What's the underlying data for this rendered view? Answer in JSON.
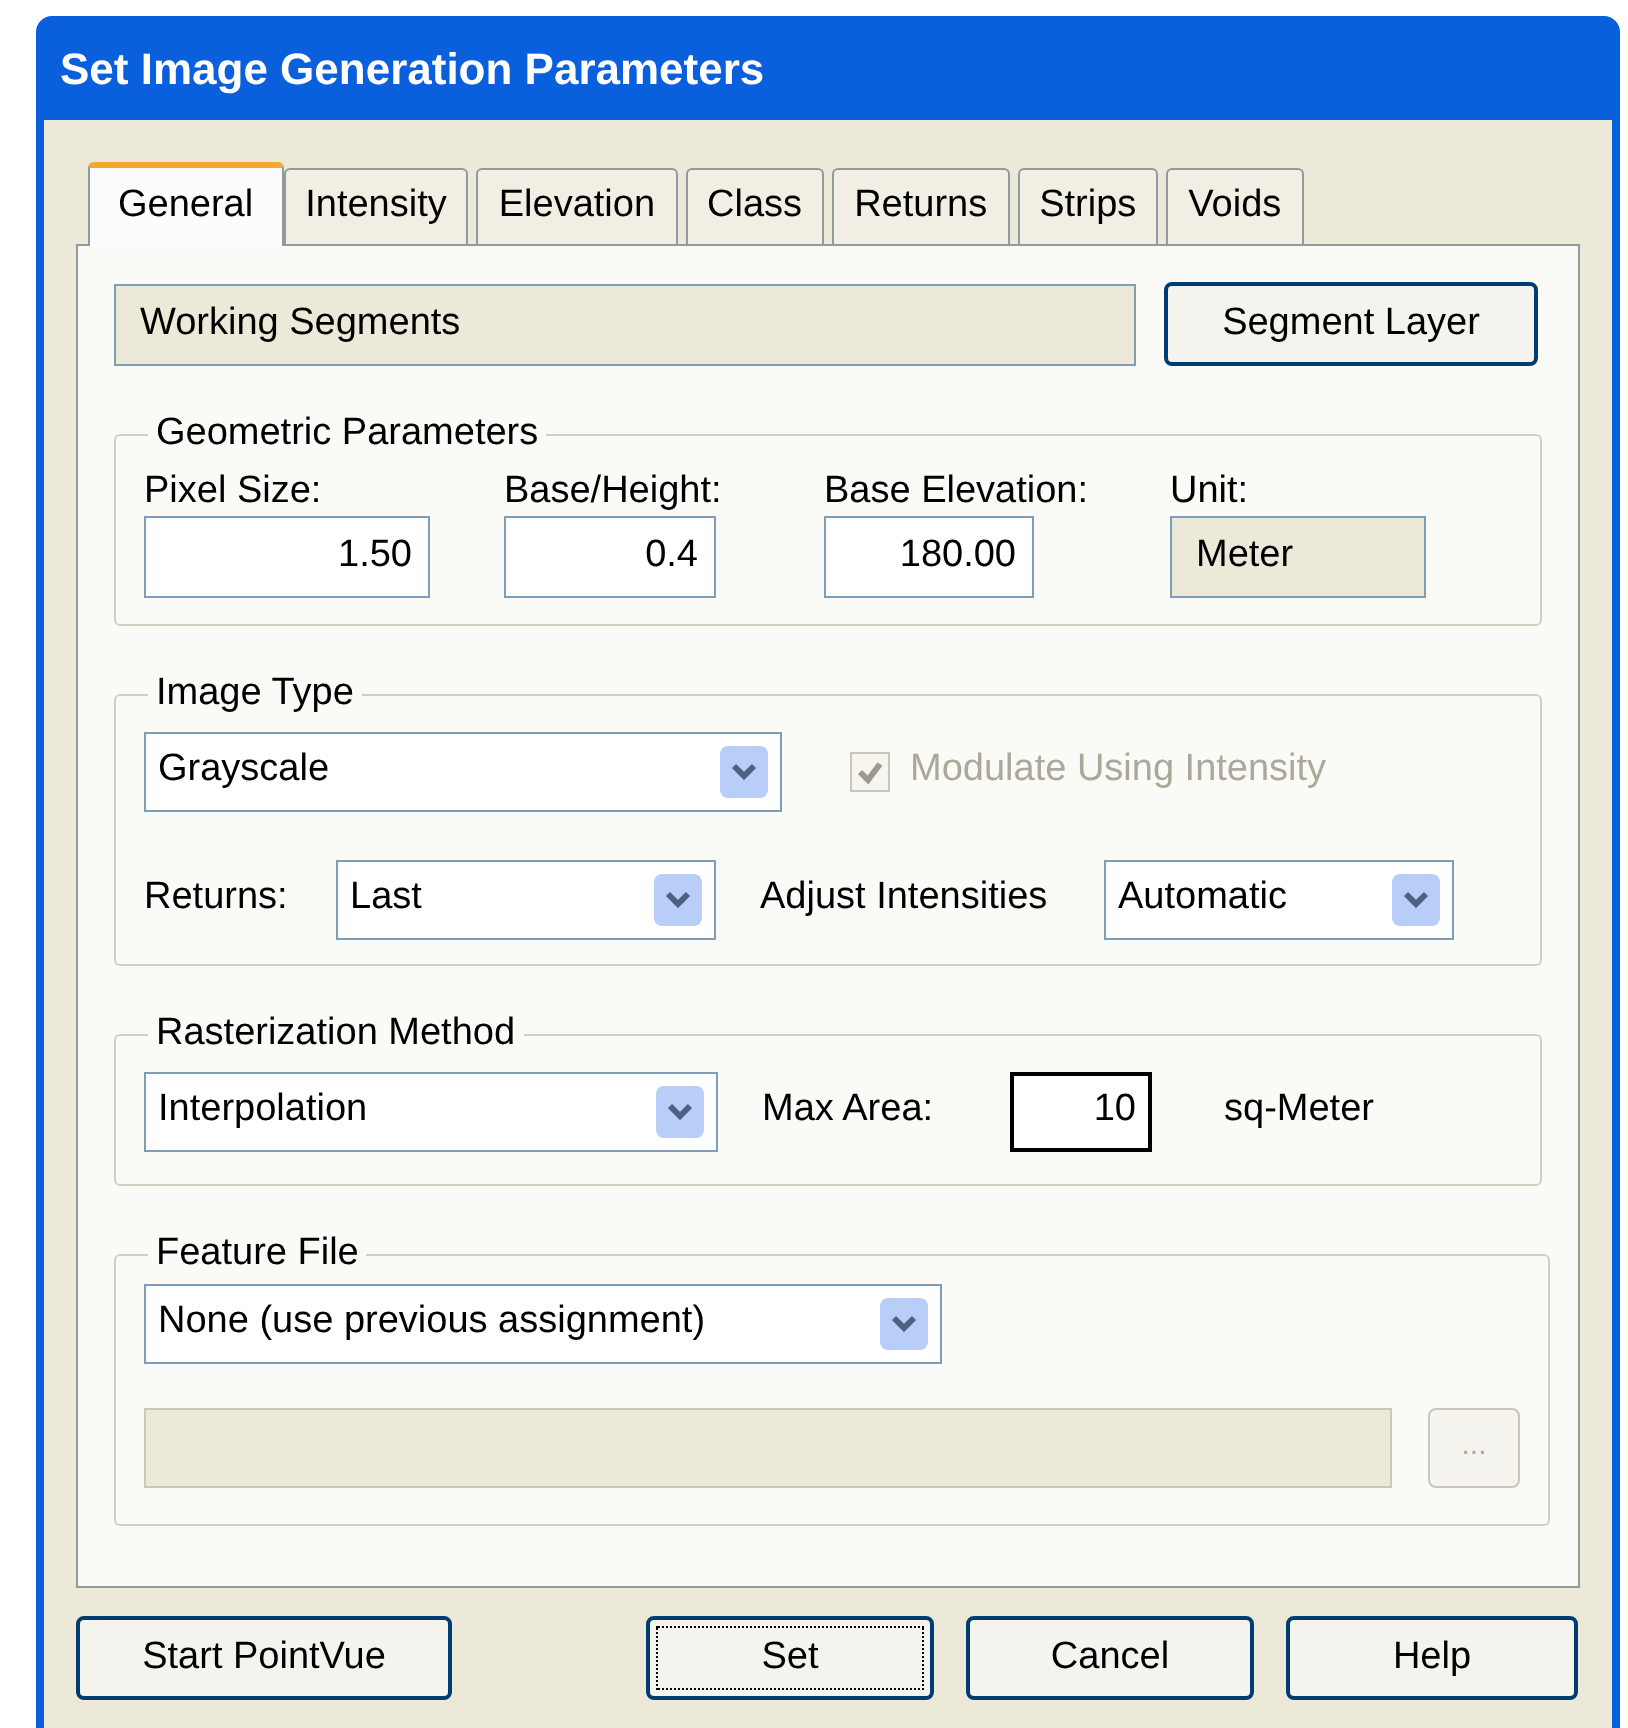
{
  "window": {
    "title": "Set Image Generation Parameters"
  },
  "tabs": [
    {
      "label": "General",
      "selected": true
    },
    {
      "label": "Intensity",
      "selected": false
    },
    {
      "label": "Elevation",
      "selected": false
    },
    {
      "label": "Class",
      "selected": false
    },
    {
      "label": "Returns",
      "selected": false
    },
    {
      "label": "Strips",
      "selected": false
    },
    {
      "label": "Voids",
      "selected": false
    }
  ],
  "working_segments": {
    "value": "Working Segments"
  },
  "segment_layer_button": {
    "label": "Segment Layer"
  },
  "geometric_parameters": {
    "title": "Geometric Parameters",
    "fields": [
      {
        "label": "Pixel Size:",
        "value": "1.50",
        "kind": "input"
      },
      {
        "label": "Base/Height:",
        "value": "0.4",
        "kind": "input"
      },
      {
        "label": "Base Elevation:",
        "value": "180.00",
        "kind": "input"
      },
      {
        "label": "Unit:",
        "value": "Meter",
        "kind": "readonly"
      }
    ]
  },
  "image_type": {
    "title": "Image Type",
    "type": {
      "value": "Grayscale"
    },
    "modulate": {
      "label": "Modulate Using Intensity",
      "checked": true,
      "disabled": true
    },
    "returns": {
      "label": "Returns:",
      "value": "Last"
    },
    "adjust_intensities": {
      "label": "Adjust Intensities",
      "value": "Automatic"
    }
  },
  "rasterization": {
    "title": "Rasterization Method",
    "method": {
      "value": "Interpolation"
    },
    "max_area": {
      "label": "Max Area:",
      "value": "10"
    },
    "unit": "sq-Meter"
  },
  "feature_file": {
    "title": "Feature File",
    "file": {
      "value": "None (use previous assignment)"
    },
    "browse_button": {
      "label": "...",
      "disabled": true
    }
  },
  "buttons": [
    {
      "label": "Start PointVue",
      "focused": false
    },
    {
      "label": "Set",
      "focused": true
    },
    {
      "label": "Cancel",
      "focused": false
    },
    {
      "label": "Help",
      "focused": false
    }
  ]
}
